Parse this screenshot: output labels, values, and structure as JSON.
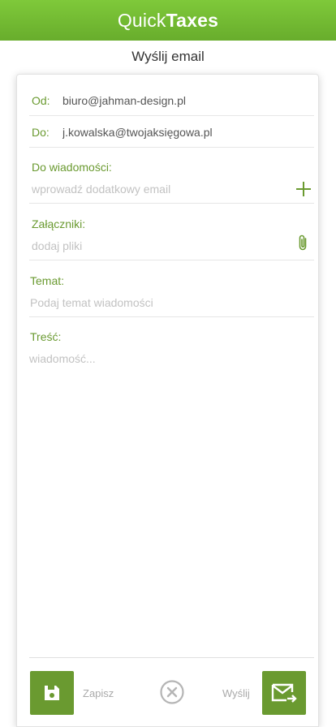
{
  "app": {
    "title_light": "Quick",
    "title_bold": "Taxes"
  },
  "page": {
    "title": "Wyślij email"
  },
  "form": {
    "from": {
      "label": "Od:",
      "value": "biuro@jahman-design.pl"
    },
    "to": {
      "label": "Do:",
      "value": "j.kowalska@twojaksięgowa.pl"
    },
    "cc": {
      "label": "Do wiadomości:",
      "placeholder": "wprowadź dodatkowy email",
      "icon": "plus-icon"
    },
    "attachments": {
      "label": "Załączniki:",
      "placeholder": "dodaj pliki",
      "icon": "paperclip-icon"
    },
    "subject": {
      "label": "Temat:",
      "placeholder": "Podaj temat wiadomości"
    },
    "body": {
      "label": "Treść:",
      "placeholder": "wiadomość..."
    }
  },
  "footer": {
    "save_label": "Zapisz",
    "send_label": "Wyślij",
    "save_icon": "floppy-disk-icon",
    "cancel_icon": "cancel-circle-icon",
    "send_icon": "envelope-send-icon"
  },
  "colors": {
    "brand_green": "#6a9a30",
    "topbar_green": "#74bb33",
    "label_green": "#6a9a30"
  }
}
